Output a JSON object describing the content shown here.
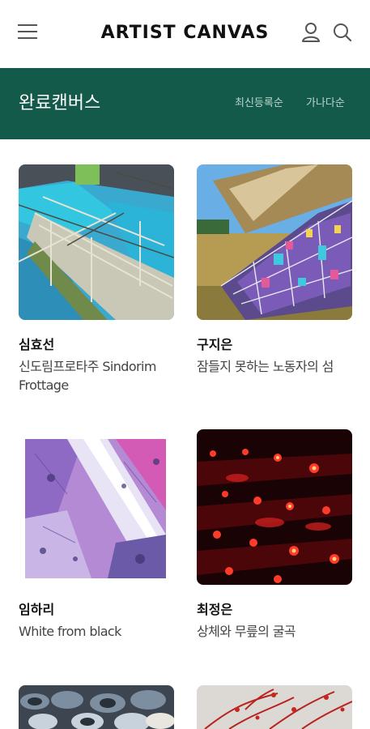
{
  "header": {
    "logo": "ARTIST CANVAS",
    "menu_icon": "hamburger-menu-icon",
    "user_icon": "user-icon",
    "search_icon": "search-icon"
  },
  "banner": {
    "title": "완료캔버스",
    "sort_options": [
      "최신등록순",
      "가나다순"
    ],
    "background": "#135a4a"
  },
  "artworks": [
    {
      "artist": "심효선",
      "title": "신도림프로타주 Sindorim Frottage"
    },
    {
      "artist": "구지은",
      "title": "잠들지 못하는 노동자의 섬"
    },
    {
      "artist": "임하리",
      "title": "White from black"
    },
    {
      "artist": "최정은",
      "title": "상체와 무릎의 굴곡"
    }
  ]
}
